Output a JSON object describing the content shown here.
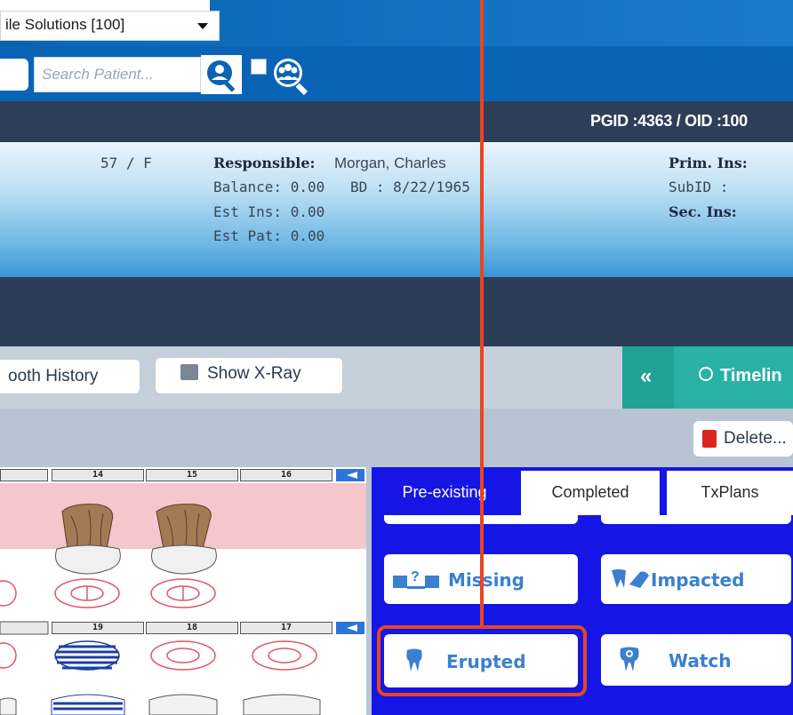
{
  "org_selector": {
    "value": "ile Solutions [100]"
  },
  "search": {
    "placeholder": "Search Patient..."
  },
  "ids": {
    "pgid": "PGID :4363 / OID :100"
  },
  "patient": {
    "age_sex": "57 / F",
    "responsible_label": "Responsible:",
    "responsible_value": "Morgan, Charles",
    "balance": "Balance: 0.00",
    "bd": "BD : 8/22/1965",
    "est_ins": "Est Ins:  0.00",
    "est_pat": "Est Pat: 0.00",
    "prim_ins_label": "Prim. Ins:",
    "subid_label": "SubID :",
    "sec_ins_label": "Sec. Ins:"
  },
  "toolbar": {
    "tooth_history": "ooth History",
    "show_xray": "Show X-Ray",
    "collapse": "«",
    "timeline": "Timelin",
    "delete": "Delete..."
  },
  "tooth_numbers_upper": [
    "14",
    "15",
    "16"
  ],
  "tooth_numbers_lower": [
    "19",
    "18",
    "17"
  ],
  "tabs": [
    "Pre-existing",
    "Completed",
    "TxPlans"
  ],
  "actions": {
    "missing": "Missing",
    "impacted": "Impacted",
    "erupted": "Erupted",
    "watch": "Watch"
  },
  "colors": {
    "highlight": "#e8461f",
    "panel_blue": "#1515e6",
    "header_blue": "#0a64b5"
  }
}
